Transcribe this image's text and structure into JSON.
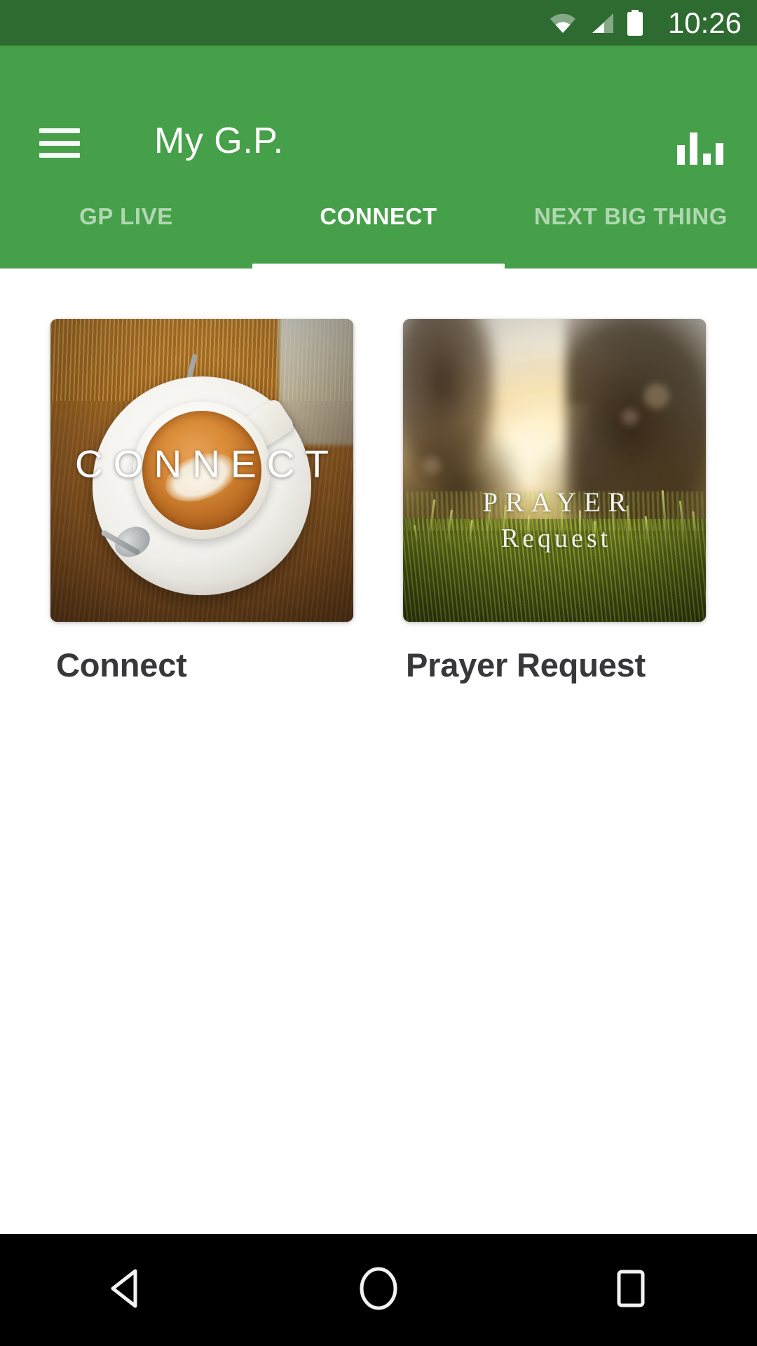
{
  "status_bar": {
    "time": "10:26",
    "icons": [
      "wifi-icon",
      "cellular-signal-icon",
      "battery-icon"
    ],
    "background_color": "#2e6b30",
    "foreground_color": "#ffffff"
  },
  "app_bar": {
    "title": "My G.P.",
    "menu_icon": "hamburger-menu-icon",
    "action_icon": "bar-chart-icon",
    "background_color": "#45a049",
    "title_color": "#ffffff"
  },
  "tabs": {
    "active_index": 1,
    "indicator_color": "#ffffff",
    "items": [
      {
        "label": "GP LIVE",
        "active": false
      },
      {
        "label": "CONNECT",
        "active": true
      },
      {
        "label": "NEXT BIG THING",
        "active": false
      }
    ]
  },
  "content": {
    "cards": [
      {
        "caption": "Connect",
        "image_overlay_line1": "CONNECT",
        "image_overlay_line2": "",
        "image_description": "coffee-cup-photo"
      },
      {
        "caption": "Prayer Request",
        "image_overlay_line1": "PRAYER",
        "image_overlay_line2": "Request",
        "image_description": "sunset-field-photo"
      }
    ],
    "background_color": "#ffffff",
    "caption_color": "#38383a"
  },
  "nav_bar": {
    "background_color": "#000000",
    "buttons": [
      {
        "name": "back-button",
        "icon": "triangle-left-icon"
      },
      {
        "name": "home-button",
        "icon": "circle-icon"
      },
      {
        "name": "recents-button",
        "icon": "square-icon"
      }
    ]
  }
}
